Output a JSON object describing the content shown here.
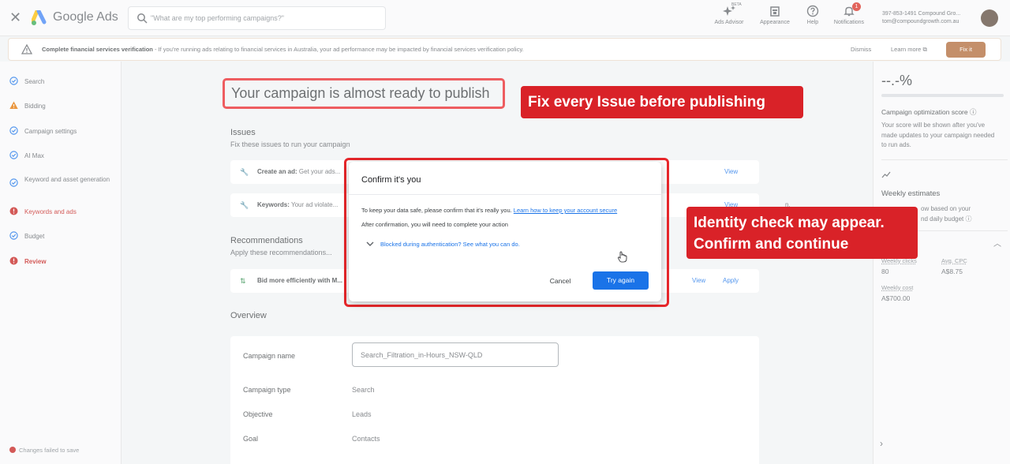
{
  "topbar": {
    "close_icon": "close-icon",
    "brand": "Google Ads",
    "search_placeholder": "\"What are my top performing campaigns?\"",
    "items": [
      {
        "label": "Ads Advisor",
        "icon": "sparkle-icon",
        "badge": "BETA"
      },
      {
        "label": "Appearance",
        "icon": "appearance-icon"
      },
      {
        "label": "Help",
        "icon": "help-icon"
      },
      {
        "label": "Notifications",
        "icon": "bell-icon",
        "count": "1"
      }
    ],
    "account_line1": "397-853-1491 Compound Gro...",
    "account_line2": "tom@compoundgrowth.com.au"
  },
  "banner": {
    "title": "Complete financial services verification",
    "text": " - If you're running ads relating to financial services in Australia, your ad performance may be impacted by financial services verification policy.",
    "dismiss": "Dismiss",
    "learn_more": "Learn more",
    "fix_it": "Fix it"
  },
  "sidebar": {
    "items": [
      {
        "label": "Search",
        "status": "done"
      },
      {
        "label": "Bidding",
        "status": "warning"
      },
      {
        "label": "Campaign settings",
        "status": "done"
      },
      {
        "label": "AI Max",
        "status": "done"
      },
      {
        "label": "Keyword and asset generation",
        "status": "done"
      },
      {
        "label": "Keywords and ads",
        "status": "error"
      },
      {
        "label": "Budget",
        "status": "done"
      },
      {
        "label": "Review",
        "status": "error"
      }
    ],
    "changes_failed": "Changes failed to save"
  },
  "main": {
    "headline": "Your campaign is almost ready to publish",
    "issues_title": "Issues",
    "issues_sub": "Fix these issues to run your campaign",
    "issue1_bold": "Create an ad:",
    "issue1_text": "Get your ads...",
    "issue1_action": "View",
    "issue2_bold": "Keywords:",
    "issue2_text": "Your ad violate...",
    "issue2_tail": "n.",
    "issue2_action": "View",
    "rec_title": "Recommendations",
    "rec_sub": "Apply these recommendations...",
    "rec1_bold": "Bid more efficiently with M...",
    "rec1_view": "View",
    "rec1_apply": "Apply",
    "overview_title": "Overview",
    "overview": {
      "campaign_name_label": "Campaign name",
      "campaign_name_value": "Search_Filtration_in-Hours_NSW-QLD",
      "campaign_type_label": "Campaign type",
      "campaign_type_value": "Search",
      "objective_label": "Objective",
      "objective_value": "Leads",
      "goal_label": "Goal",
      "goal_value": "Contacts"
    }
  },
  "right_panel": {
    "score": "--.-%",
    "score_title": "Campaign optimization score",
    "score_text": "Your score will be shown after you've made updates to your campaign needed to run ads.",
    "weekly_title": "Weekly estimates",
    "weekly_text_tail": "ow based on your",
    "weekly_text_tail2": "nd daily budget",
    "clicks_label": "Weekly clicks",
    "clicks_value": "80",
    "cpc_label": "Avg. CPC",
    "cpc_value": "A$8.75",
    "cost_label": "Weekly cost",
    "cost_value": "A$700.00"
  },
  "dialog": {
    "title": "Confirm it's you",
    "body": "To keep your data safe, please confirm that it's really you.",
    "link": "Learn how to keep your account secure",
    "body2": "After confirmation, you will need to complete your action",
    "expand": "Blocked during authentication? See what you can do.",
    "cancel": "Cancel",
    "try_again": "Try again"
  },
  "callouts": {
    "callout1": "Fix every Issue before publishing",
    "callout2_line1": "Identity check may appear.",
    "callout2_line2": "Confirm and continue"
  },
  "colors": {
    "accent_blue": "#1a73e8",
    "error_red": "#c5221f",
    "callout_red": "#d92228",
    "fix_button": "#b06a38"
  }
}
